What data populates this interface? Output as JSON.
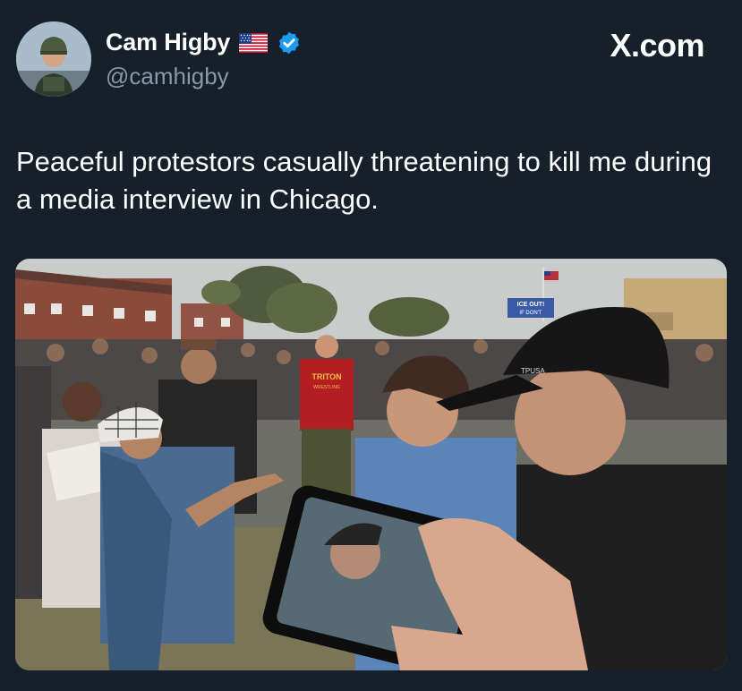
{
  "brand": "X.com",
  "tweet": {
    "author": {
      "display_name": "Cam Higby",
      "handle": "@camhigby",
      "badges": [
        "us-flag-icon",
        "verified-icon"
      ],
      "verified_color": "#1d9bf0"
    },
    "text": "Peaceful protestors casually threatening to kill me during a media interview in Chicago.",
    "media": {
      "type": "photo",
      "sign_text": "ICE OUT! IF DON'T",
      "shirt_text": "TRITON WRESTLING",
      "cap_text": "TPUSA"
    }
  },
  "colors": {
    "background": "#15202b",
    "text_primary": "#ffffff",
    "text_secondary": "#8b98a5"
  }
}
